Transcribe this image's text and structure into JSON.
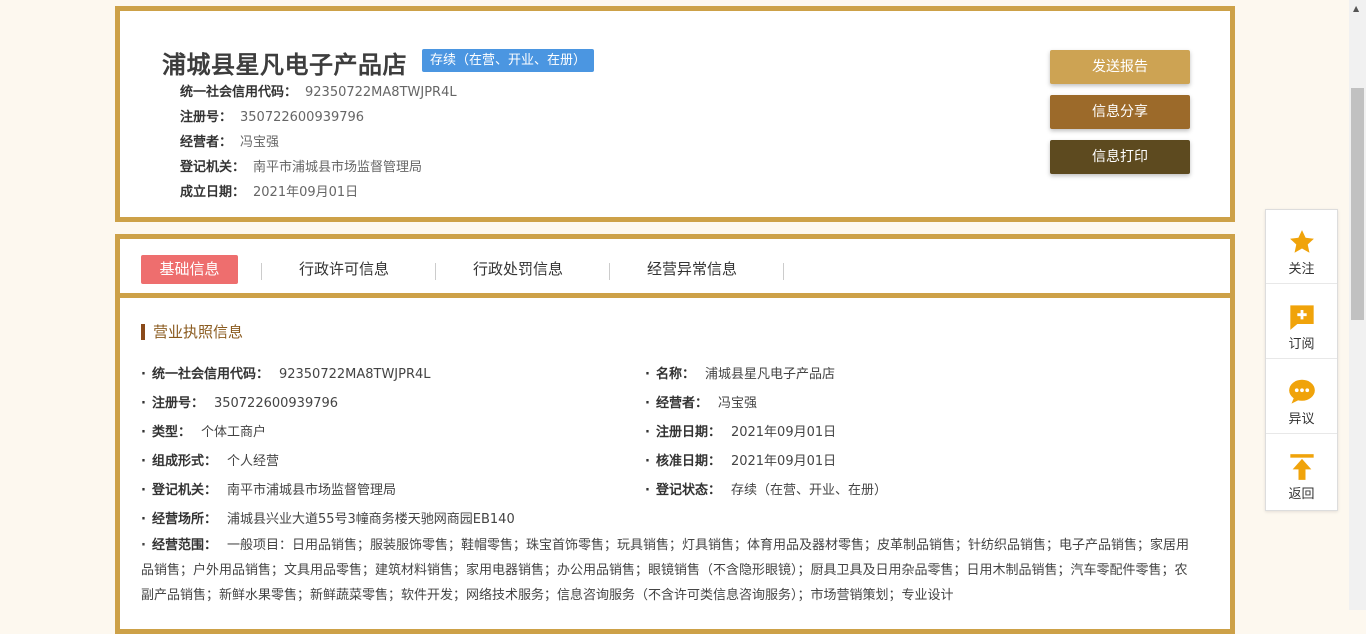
{
  "company": {
    "name": "浦城县星凡电子产品店",
    "status_badge": "存续（在营、开业、在册）",
    "credit_code_label": "统一社会信用代码：",
    "credit_code": "92350722MA8TWJPR4L",
    "reg_no_label": "注册号：",
    "reg_no": "350722600939796",
    "operator_label": "经营者：",
    "operator": "冯宝强",
    "authority_label": "登记机关：",
    "authority": "南平市浦城县市场监督管理局",
    "founded_label": "成立日期：",
    "founded": "2021年09月01日"
  },
  "actions": {
    "send_report": "发送报告",
    "share": "信息分享",
    "print": "信息打印"
  },
  "tabs": [
    {
      "label": "基础信息"
    },
    {
      "label": "行政许可信息"
    },
    {
      "label": "行政处罚信息"
    },
    {
      "label": "经营异常信息"
    }
  ],
  "license": {
    "section_title": "营业执照信息",
    "dot": "·",
    "fields": {
      "credit_code": {
        "label": "统一社会信用代码：",
        "value": "92350722MA8TWJPR4L"
      },
      "name": {
        "label": "名称：",
        "value": "浦城县星凡电子产品店"
      },
      "reg_no": {
        "label": "注册号：",
        "value": "350722600939796"
      },
      "operator": {
        "label": "经营者：",
        "value": "冯宝强"
      },
      "type": {
        "label": "类型：",
        "value": "个体工商户"
      },
      "reg_date": {
        "label": "注册日期：",
        "value": "2021年09月01日"
      },
      "form": {
        "label": "组成形式：",
        "value": "个人经营"
      },
      "approve_date": {
        "label": "核准日期：",
        "value": "2021年09月01日"
      },
      "authority": {
        "label": "登记机关：",
        "value": "南平市浦城县市场监督管理局"
      },
      "reg_status": {
        "label": "登记状态：",
        "value": "存续（在营、开业、在册）"
      },
      "address": {
        "label": "经营场所：",
        "value": "浦城县兴业大道55号3幢商务楼天驰网商园EB140"
      }
    },
    "scope_label": "经营范围：",
    "scope_value": "一般项目：日用品销售；服装服饰零售；鞋帽零售；珠宝首饰零售；玩具销售；灯具销售；体育用品及器材零售；皮革制品销售；针纺织品销售；电子产品销售；家居用品销售；户外用品销售；文具用品零售；建筑材料销售；家用电器销售；办公用品销售；眼镜销售（不含隐形眼镜）；厨具卫具及日用杂品零售；日用木制品销售；汽车零配件零售；农副产品销售；新鲜水果零售；新鲜蔬菜零售；软件开发；网络技术服务；信息咨询服务（不含许可类信息咨询服务）；市场营销策划；专业设计"
  },
  "side": {
    "follow": "关注",
    "subscribe": "订阅",
    "objection": "异议",
    "back": "返回"
  },
  "colors": {
    "border_gold": "#cda148",
    "badge_blue": "#4b96e1",
    "tab_active": "#ee6e6e",
    "icon_orange": "#f0a30a"
  }
}
